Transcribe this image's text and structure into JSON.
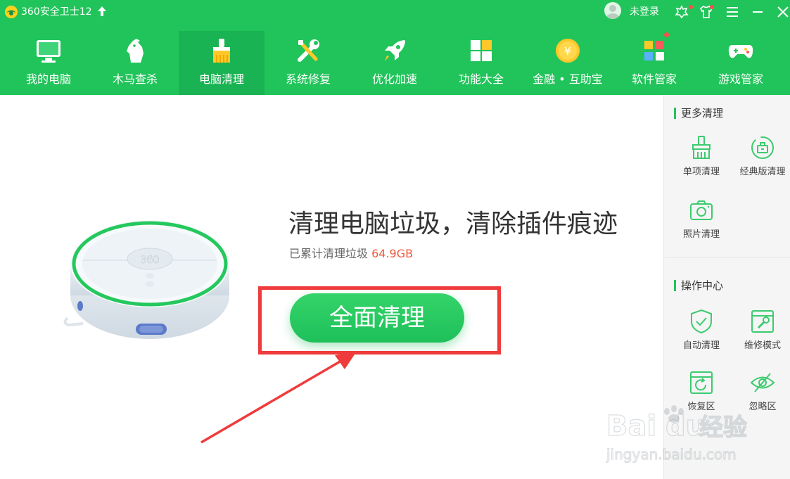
{
  "app": {
    "title": "360安全卫士12",
    "login_text": "未登录"
  },
  "nav": {
    "items": [
      {
        "label": "我的电脑",
        "icon": "monitor-icon"
      },
      {
        "label": "木马查杀",
        "icon": "horse-icon"
      },
      {
        "label": "电脑清理",
        "icon": "broom-icon",
        "active": true
      },
      {
        "label": "系统修复",
        "icon": "wrench-icon"
      },
      {
        "label": "优化加速",
        "icon": "rocket-icon"
      },
      {
        "label": "功能大全",
        "icon": "grid-icon"
      },
      {
        "label": "金融 • 互助宝",
        "icon": "coin-icon"
      },
      {
        "label": "软件管家",
        "icon": "apps-icon"
      },
      {
        "label": "游戏管家",
        "icon": "gamepad-icon"
      }
    ]
  },
  "main": {
    "headline": "清理电脑垃圾，清除插件痕迹",
    "cumulative_prefix": "已累计清理垃圾",
    "cumulative_value": "64.9GB",
    "clean_button": "全面清理",
    "robot_badge": "360"
  },
  "sidebar": {
    "more_title": "更多清理",
    "more_items": [
      {
        "label": "单项清理",
        "icon": "brush-icon"
      },
      {
        "label": "经典版清理",
        "icon": "classic-clean-icon"
      },
      {
        "label": "照片清理",
        "icon": "camera-icon"
      }
    ],
    "ops_title": "操作中心",
    "ops_items": [
      {
        "label": "自动清理",
        "icon": "shield-check-icon"
      },
      {
        "label": "维修模式",
        "icon": "repair-window-icon"
      },
      {
        "label": "恢复区",
        "icon": "restore-icon"
      },
      {
        "label": "忽略区",
        "icon": "eye-off-icon"
      }
    ]
  },
  "watermark": {
    "brand_a": "Bai",
    "brand_b": "du",
    "brand_c": "经验",
    "url": "jingyan.baidu.com"
  },
  "colors": {
    "brand_green": "#21c45a",
    "active_tab": "#1ab353",
    "highlight_red": "#ef3b3b",
    "value_orange": "#f0593f"
  }
}
